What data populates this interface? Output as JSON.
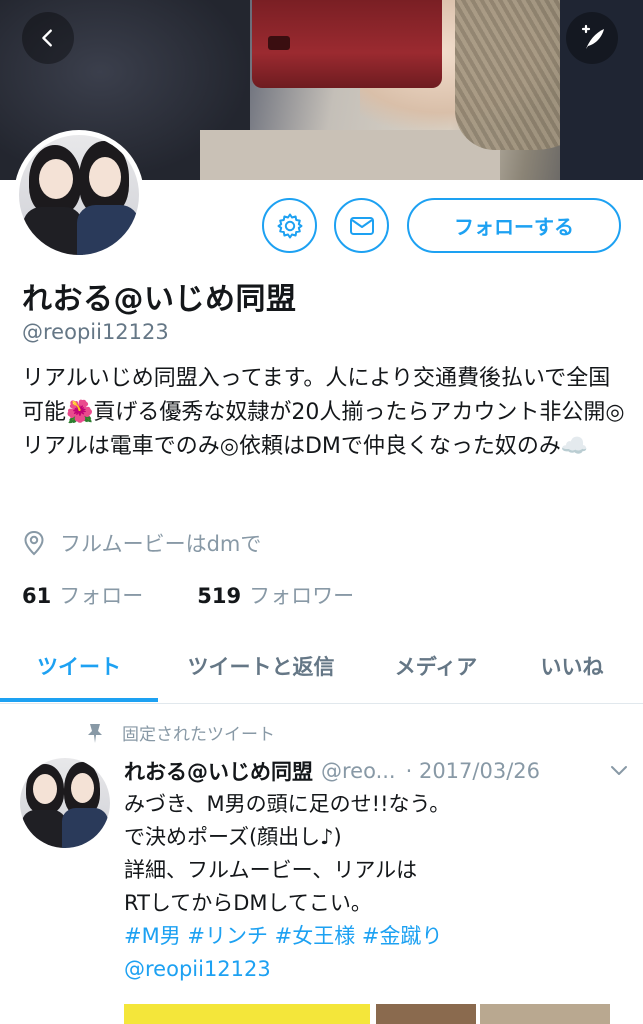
{
  "header": {
    "back_icon": "chevron-left-icon",
    "compose_icon": "compose-tweet-icon"
  },
  "profile": {
    "name": "れおる@いじめ同盟",
    "handle": "@reopii12123",
    "bio": "リアルいじめ同盟入ってます。人により交通費後払いで全国可能🌺貢げる優秀な奴隷が20人揃ったらアカウント非公開◎リアルは電車でのみ◎依頼はDMで仲良くなった奴のみ☁️",
    "location": "フルムービーはdmで",
    "following_count": "61",
    "following_label": "フォロー",
    "followers_count": "519",
    "followers_label": "フォロワー"
  },
  "actions": {
    "settings_icon": "gear-icon",
    "message_icon": "envelope-icon",
    "follow_label": "フォローする"
  },
  "tabs": [
    {
      "label": "ツイート",
      "active": true
    },
    {
      "label": "ツイートと返信",
      "active": false
    },
    {
      "label": "メディア",
      "active": false
    },
    {
      "label": "いいね",
      "active": false
    }
  ],
  "pinned_tweet": {
    "pinned_label": "固定されたツイート",
    "name": "れおる@いじめ同盟",
    "handle": "@reo...",
    "date": "· 2017/03/26",
    "lines": [
      "みづき、M男の頭に足のせ!!なう。",
      "で決めポーズ(顔出し♪)",
      "詳細、フルムービー、リアルは",
      "RTしてからDMしてこい。"
    ],
    "hashtags": "#M男 #リンチ #女王様 #金蹴り",
    "mention": "@reopii12123"
  },
  "colors": {
    "accent": "#1da1f2",
    "secondary_text": "#657786",
    "muted_text": "#8899a6"
  }
}
